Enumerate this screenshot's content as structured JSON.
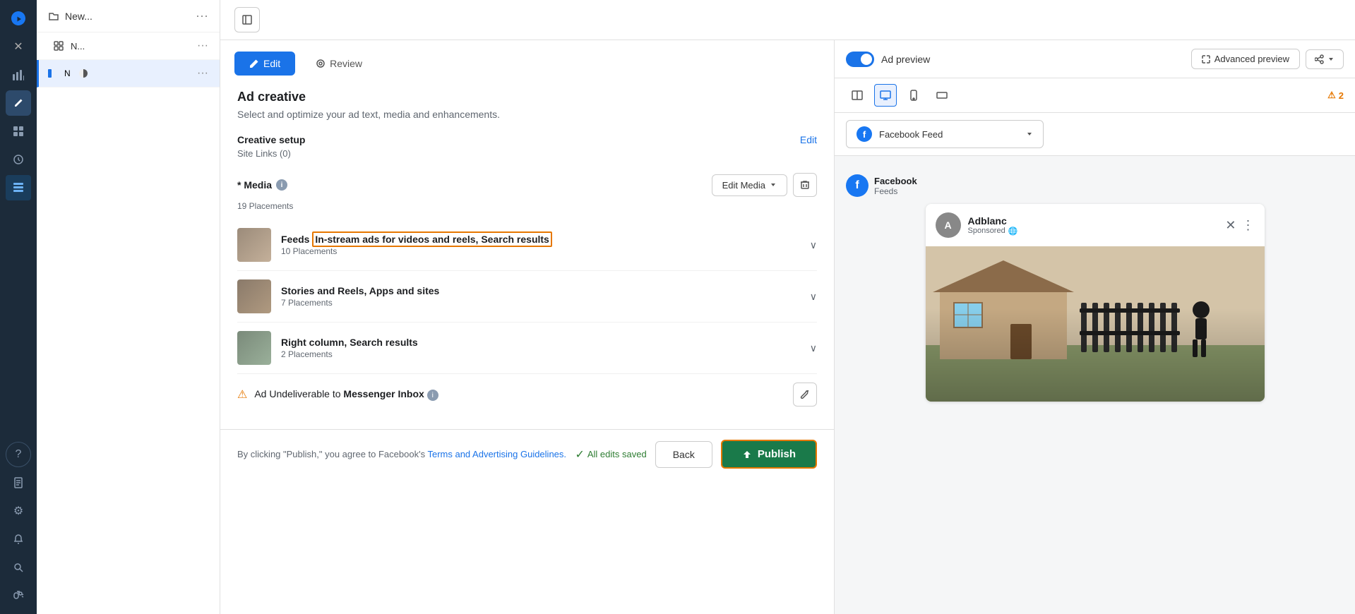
{
  "sidebar": {
    "items": [
      {
        "id": "meta-logo",
        "icon": "🔷",
        "label": "Meta"
      },
      {
        "id": "close",
        "icon": "✕",
        "label": "Close"
      },
      {
        "id": "analytics",
        "icon": "📊",
        "label": "Analytics"
      },
      {
        "id": "edit",
        "icon": "✏️",
        "label": "Edit",
        "active": true
      },
      {
        "id": "dashboard",
        "icon": "⊞",
        "label": "Dashboard"
      },
      {
        "id": "history",
        "icon": "🕐",
        "label": "History"
      },
      {
        "id": "table",
        "icon": "⊟",
        "label": "Table"
      },
      {
        "id": "help",
        "icon": "?",
        "label": "Help"
      },
      {
        "id": "pages",
        "icon": "📄",
        "label": "Pages"
      },
      {
        "id": "settings",
        "icon": "⚙",
        "label": "Settings"
      },
      {
        "id": "bell",
        "icon": "🔔",
        "label": "Notifications"
      },
      {
        "id": "search",
        "icon": "🔍",
        "label": "Search"
      },
      {
        "id": "debug",
        "icon": "🐛",
        "label": "Debug"
      }
    ]
  },
  "left_nav": {
    "header_title": "New...",
    "items": [
      {
        "id": "item1",
        "icon": "⊞",
        "label": "N...",
        "active": false
      },
      {
        "id": "item2",
        "icon": "◑",
        "label": "",
        "active": true
      }
    ]
  },
  "tabs": {
    "edit_label": "Edit",
    "review_label": "Review",
    "active": "edit"
  },
  "ad_creative": {
    "title": "Ad creative",
    "subtitle": "Select and optimize your ad text, media and enhancements.",
    "creative_setup": {
      "label": "Creative setup",
      "edit_label": "Edit",
      "site_links": "Site Links (0)"
    },
    "media": {
      "label": "* Media",
      "placements_count": "19 Placements",
      "edit_media_label": "Edit Media",
      "placement_groups": [
        {
          "id": "feeds",
          "name": "Feeds",
          "highlighted_parts": [
            "In-stream ads for videos and reels,",
            "Search results"
          ],
          "count": "10 Placements"
        },
        {
          "id": "stories",
          "name": "Stories and Reels, Apps and sites",
          "count": "7 Placements"
        },
        {
          "id": "right_col",
          "name": "Right column, Search results",
          "count": "2 Placements"
        }
      ],
      "warning": {
        "text_prefix": "Ad Undeliverable to",
        "text_bold": "Messenger Inbox"
      }
    }
  },
  "preview": {
    "ad_preview_label": "Ad preview",
    "advanced_preview_label": "Advanced preview",
    "platform": "Facebook Feed",
    "facebook_label": "Facebook",
    "feeds_label": "Feeds",
    "username": "Adblanc",
    "sponsored_label": "Sponsored",
    "warning_count": "2",
    "devices": [
      {
        "id": "desktop-split",
        "icon": "⊟",
        "label": "Split view"
      },
      {
        "id": "desktop",
        "icon": "⊡",
        "label": "Desktop",
        "active": true
      },
      {
        "id": "mobile",
        "icon": "📱",
        "label": "Mobile"
      },
      {
        "id": "landscape",
        "icon": "⊟",
        "label": "Landscape"
      }
    ]
  },
  "bottom_bar": {
    "terms_text": "By clicking \"Publish,\" you agree to Facebook's",
    "terms_link_label": "Terms and Advertising Guidelines.",
    "saved_text": "All edits saved",
    "back_label": "Back",
    "publish_label": "Publish"
  }
}
